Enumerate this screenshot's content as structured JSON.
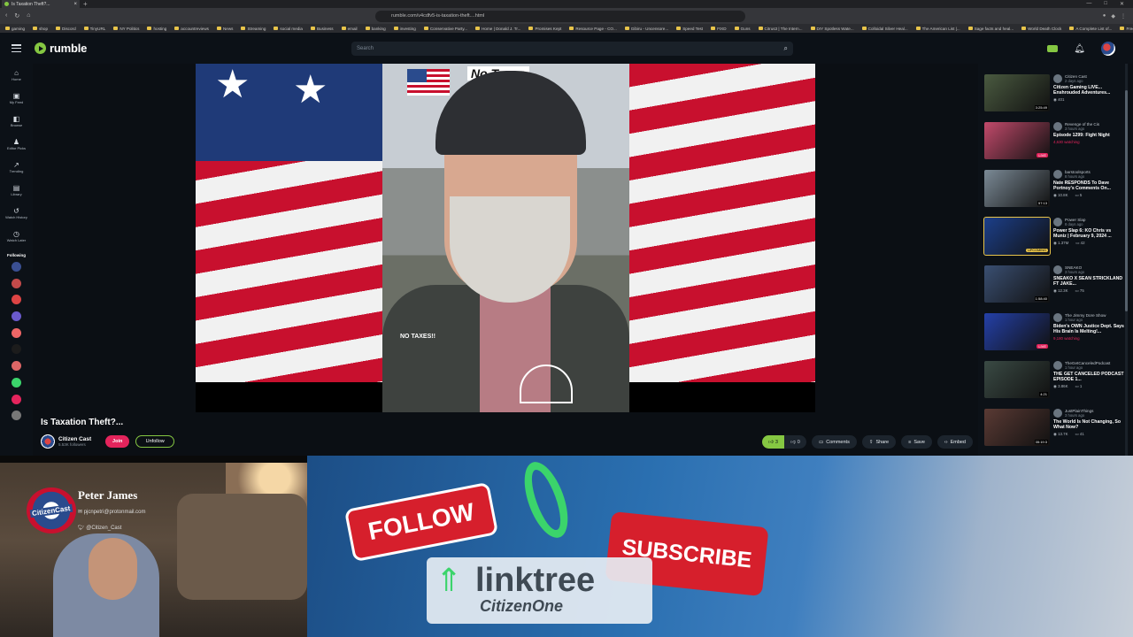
{
  "browser": {
    "tab_title": "Is Taxation Theft?...",
    "url": "rumble.com/v4cdfv5-is-taxation-theft....html",
    "bookmarks": [
      "gaming",
      "shop",
      "Discord",
      "TinyURL",
      "NY Politics",
      "hosting",
      "accountreviews",
      "News",
      "Streaming",
      "social media",
      "Business",
      "email",
      "banking",
      "investing",
      "Conservative Party...",
      "Home | Donald J. Tr...",
      "Promises Kept",
      "Resource Page - CO...",
      "Gibiru - Uncensore...",
      "Speed Test",
      "FIXD",
      "Guns",
      "Citrus3 | The Intern...",
      "DIY Spotless Wate...",
      "Colloidal Silver Heal...",
      "The American List |...",
      "Sage facts and heal...",
      "World Death Clock",
      "A Complete List of...",
      "Free Sound Effects &..."
    ]
  },
  "header": {
    "logo_text": "rumble",
    "search_placeholder": "Search",
    "accent": "#85c742"
  },
  "sidebar": {
    "items": [
      {
        "icon": "home-icon",
        "glyph": "⌂",
        "label": "Home"
      },
      {
        "icon": "feed-icon",
        "glyph": "▣",
        "label": "My Feed"
      },
      {
        "icon": "browse-icon",
        "glyph": "◧",
        "label": "Browse"
      },
      {
        "icon": "editor-picks-icon",
        "glyph": "♟",
        "label": "Editor Picks"
      },
      {
        "icon": "trending-icon",
        "glyph": "↗",
        "label": "Trending"
      },
      {
        "icon": "library-icon",
        "glyph": "▤",
        "label": "Library"
      },
      {
        "icon": "history-icon",
        "glyph": "↺",
        "label": "Watch History"
      },
      {
        "icon": "watch-later-icon",
        "glyph": "◷",
        "label": "Watch Later"
      }
    ],
    "following_label": "Following"
  },
  "video": {
    "overlay_text": "No Taxes",
    "shirt_text": "NO TAXES!!",
    "title": "Is Taxation Theft?...",
    "channel": "Citizen Cast",
    "followers": "5.53K followers",
    "join_label": "Join",
    "unfollow_label": "Unfollow",
    "upvotes": "3",
    "downvotes": "0",
    "comments_label": "Comments",
    "share_label": "Share",
    "save_label": "Save",
    "embed_label": "Embed"
  },
  "related": [
    {
      "channel": "Citizen Cast",
      "age": "2 days ago",
      "title": "Citizen Gaming LIVE... Enshrouded Adventures...",
      "views": "401",
      "comments": "",
      "badge": "3:25:49",
      "badge_type": "dur",
      "color": "#4a5a40"
    },
    {
      "channel": "Revenge of the Cis",
      "age": "3 hours ago",
      "title": "Episode 1299: Fight Night",
      "views": "4,630 watching",
      "comments": "",
      "badge": "LIVE",
      "badge_type": "live",
      "color": "#c24a6b"
    },
    {
      "channel": "barstoolsports",
      "age": "8 hours ago",
      "title": "Nate RESPONDS To Dave Portnoy's Comments On...",
      "views": "10.8K",
      "comments": "5",
      "badge": "57:13",
      "badge_type": "dur",
      "color": "#7b8a96"
    },
    {
      "channel": "Power Slap",
      "age": "8 days ago",
      "title": "Power Slap 6: KO Chris vs Muniz | February 9, 2024 ...",
      "views": "1.37M",
      "comments": "42",
      "badge": "UPCOMING",
      "badge_type": "upc",
      "color": "#1c3f8a"
    },
    {
      "channel": "SNEAKO",
      "age": "3 hours ago",
      "title": "SNEAKO X SEAN STRICKLAND FT JAKE...",
      "views": "12.3K",
      "comments": "75",
      "badge": "1:58:40",
      "badge_type": "dur",
      "color": "#3a4f72"
    },
    {
      "channel": "The Jimmy Dore Show",
      "age": "1 hour ago",
      "title": "Biden's OWN Justice Dept. Says His Brain Is Melting!...",
      "views": "9,180 watching",
      "comments": "",
      "badge": "LIVE",
      "badge_type": "live",
      "color": "#2440a8"
    },
    {
      "channel": "TheGetCanceledPodcast",
      "age": "1 hour ago",
      "title": "THE GET CANCELED PODCAST EPISODE 1...",
      "views": "3.86K",
      "comments": "1",
      "badge": "4:21",
      "badge_type": "dur",
      "color": "#3a4a44"
    },
    {
      "channel": "JustPlainThings",
      "age": "3 hours ago",
      "title": "The World Is Not Changing, So What Now?",
      "views": "13.7K",
      "comments": "41",
      "badge": "35:19:3",
      "badge_type": "dur",
      "color": "#5a3a34"
    }
  ],
  "overlay": {
    "name": "Peter James",
    "email": "pjcnpetri@protonmail.com",
    "twitter": "@Citizen_Cast",
    "logo_text": "CitizenCast",
    "follow_label": "FOLLOW",
    "subscribe_label": "SUBSCRIBE",
    "linktree_label": "linktree",
    "linktree_user": "CitizenOne"
  }
}
